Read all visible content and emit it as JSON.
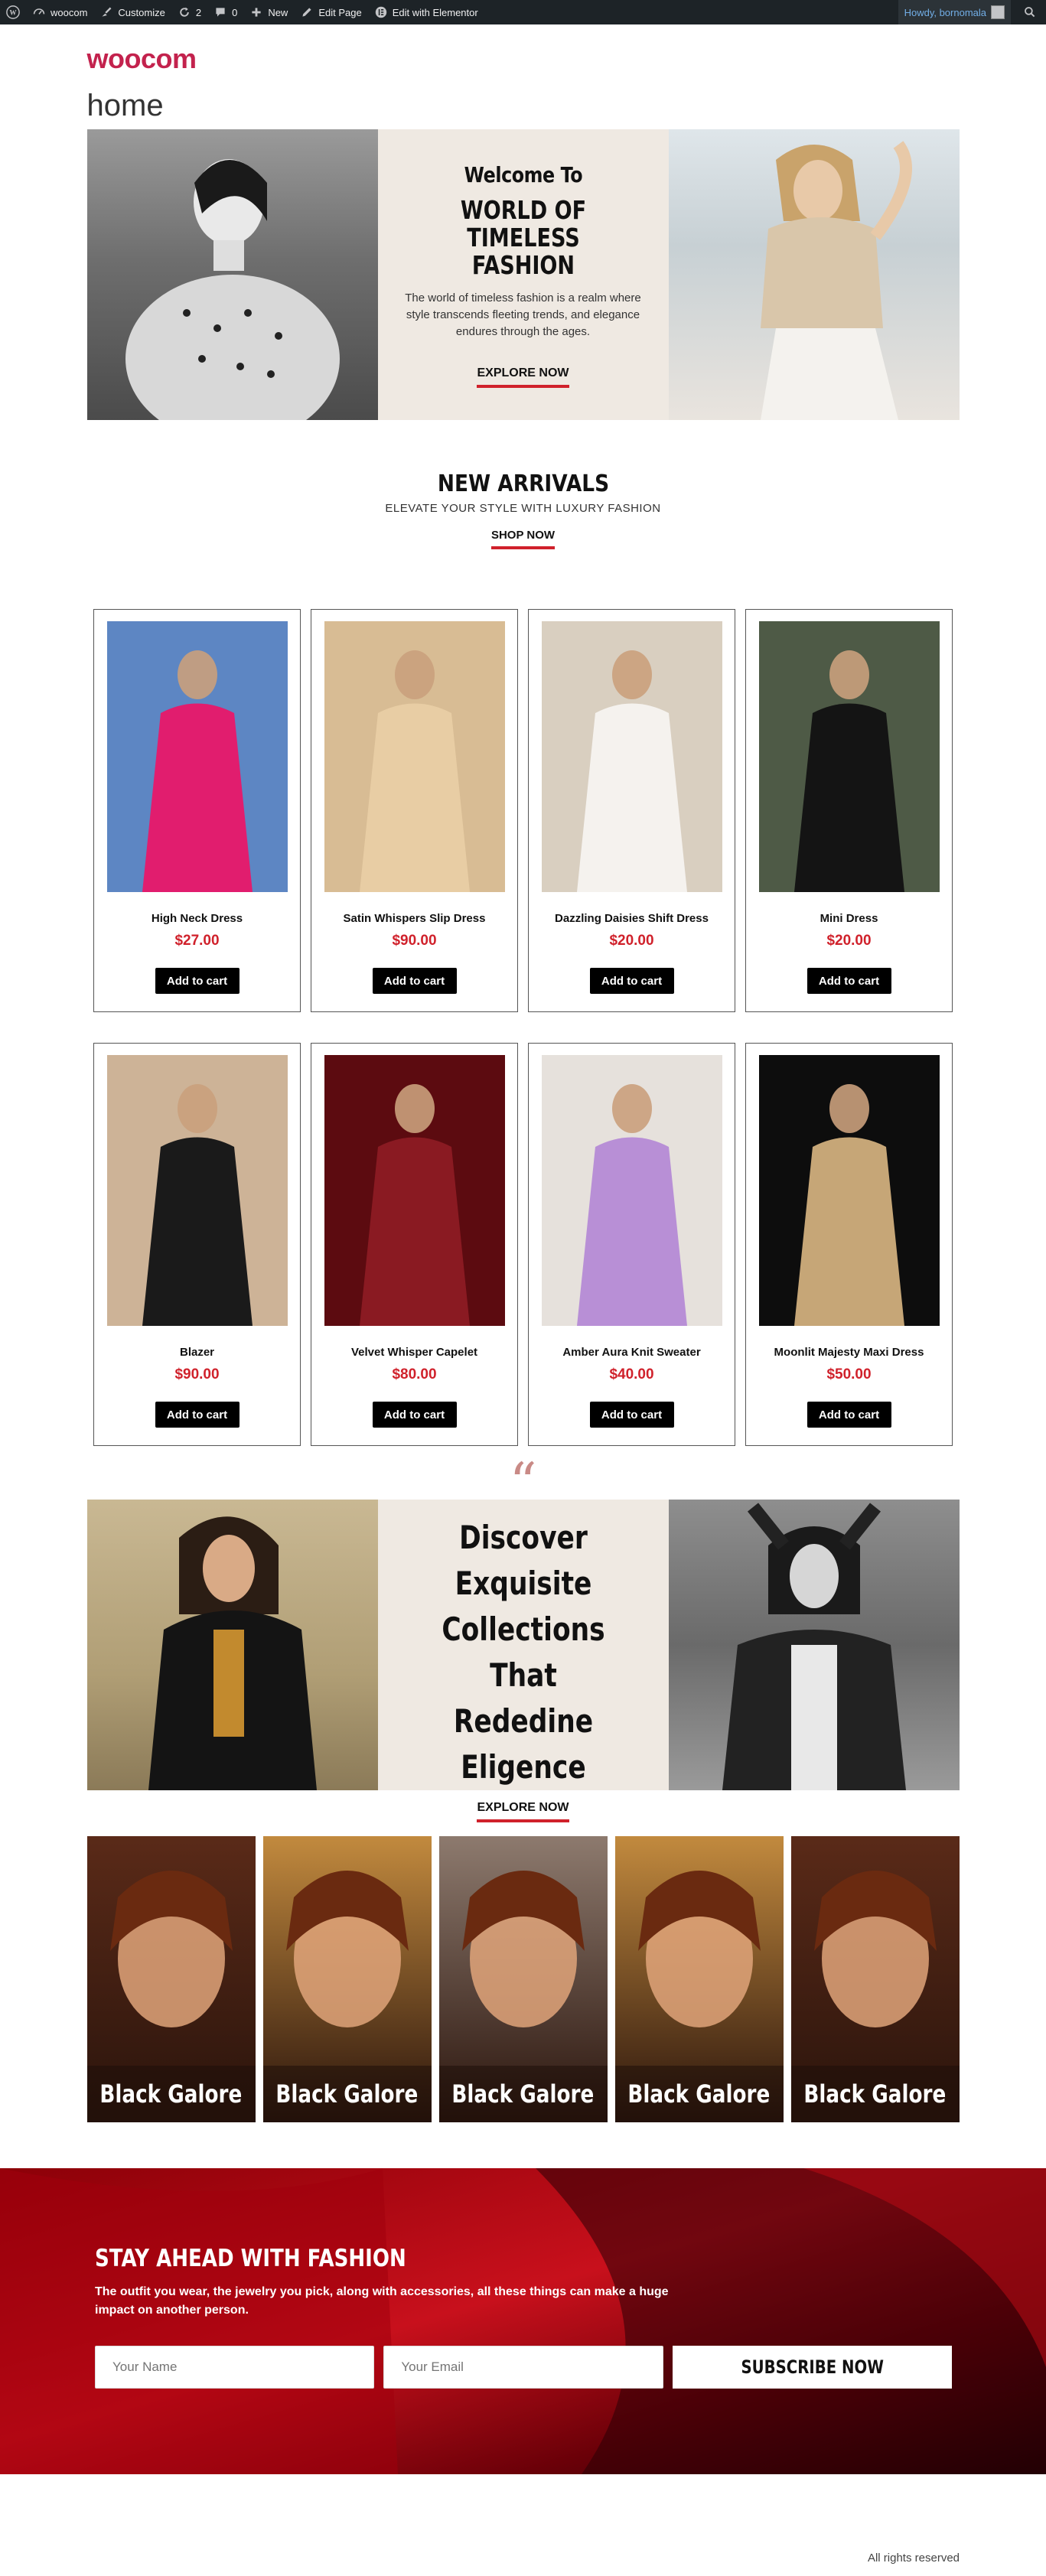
{
  "admin_bar": {
    "site_name": "woocom",
    "customize": "Customize",
    "updates_count": "2",
    "comments_count": "0",
    "new_label": "New",
    "edit_page": "Edit Page",
    "edit_elementor": "Edit with Elementor",
    "howdy": "Howdy, bornomala"
  },
  "site": {
    "logo": "woocom",
    "page_title": "home"
  },
  "hero": {
    "welcome": "Welcome To",
    "title": "WORLD OF TIMELESS FASHION",
    "description": "The world of timeless fashion is a realm where style transcends fleeting trends, and elegance endures through the ages.",
    "cta": "EXPLORE NOW"
  },
  "arrivals": {
    "title": "NEW ARRIVALS",
    "subtitle": "ELEVATE YOUR STYLE WITH LUXURY FASHION",
    "cta": "SHOP NOW"
  },
  "products": [
    {
      "name": "High Neck Dress",
      "price": "$27.00",
      "button": "Add to cart",
      "bg": "#5d86c3",
      "fg": "#e11d6e"
    },
    {
      "name": "Satin Whispers Slip Dress",
      "price": "$90.00",
      "button": "Add to cart",
      "bg": "#d8bc94",
      "fg": "#e8cda4"
    },
    {
      "name": "Dazzling Daisies Shift Dress",
      "price": "$20.00",
      "button": "Add to cart",
      "bg": "#d9cfc0",
      "fg": "#f5f2ee"
    },
    {
      "name": "Mini Dress",
      "price": "$20.00",
      "button": "Add to cart",
      "bg": "#4e5a46",
      "fg": "#141414"
    },
    {
      "name": "Blazer",
      "price": "$90.00",
      "button": "Add to cart",
      "bg": "#cdb397",
      "fg": "#1a1a1a"
    },
    {
      "name": "Velvet Whisper Capelet",
      "price": "$80.00",
      "button": "Add to cart",
      "bg": "#5c0b10",
      "fg": "#8a1a22"
    },
    {
      "name": "Amber Aura Knit Sweater",
      "price": "$40.00",
      "button": "Add to cart",
      "bg": "#e6e1dc",
      "fg": "#b88fd6"
    },
    {
      "name": "Moonlit Majesty Maxi Dress",
      "price": "$50.00",
      "button": "Add to cart",
      "bg": "#0d0d0d",
      "fg": "#c6a677"
    }
  ],
  "discover": {
    "title_lines": [
      "Discover Exquisite",
      "Collections That",
      "Rededine Eligence"
    ],
    "cta": "EXPLORE NOW"
  },
  "galore": [
    {
      "label": "Black Galore",
      "bg": "#5a2a18"
    },
    {
      "label": "Black Galore",
      "bg": "#c28a3e"
    },
    {
      "label": "Black Galore",
      "bg": "#8d7a6e"
    },
    {
      "label": "Black Galore",
      "bg": "#c28a3e"
    },
    {
      "label": "Black Galore",
      "bg": "#5a2a18"
    }
  ],
  "subscribe": {
    "title": "STAY AHEAD WITH FASHION",
    "text": "The outfit you wear, the jewelry you pick, along with accessories, all these things can make a huge impact on another person.",
    "name_placeholder": "Your Name",
    "email_placeholder": "Your Email",
    "button": "SUBSCRIBE NOW"
  },
  "footer": {
    "copyright": "All rights reserved"
  },
  "colors": {
    "accent": "#d0212b",
    "logo": "#c3224d",
    "cream": "#efe9e2"
  }
}
